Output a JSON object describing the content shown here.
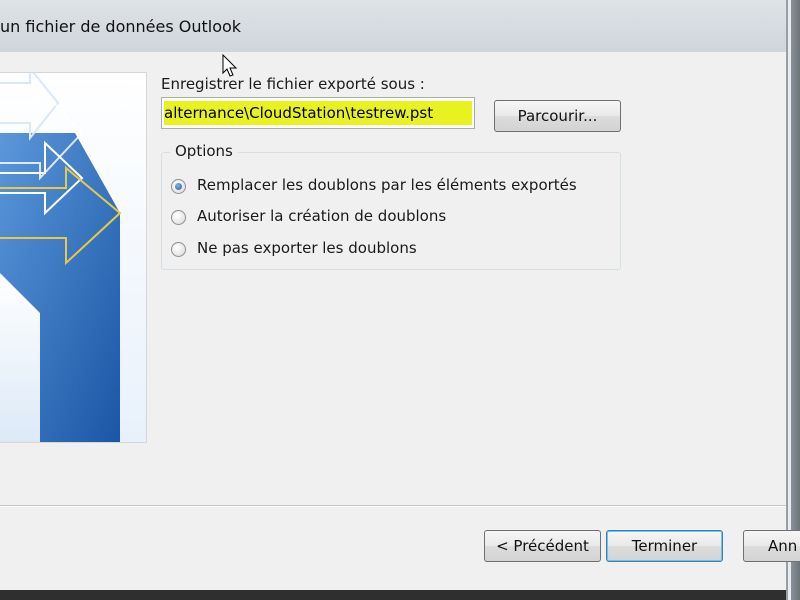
{
  "window": {
    "title": "un fichier de données Outlook"
  },
  "form": {
    "save_as_label": "Enregistrer le fichier exporté sous :",
    "path_value": "alternance\\CloudStation\\testrew.pst",
    "browse_label": "Parcourir..."
  },
  "options": {
    "legend": "Options",
    "items": [
      {
        "label": "Remplacer les doublons par les éléments exportés",
        "selected": true
      },
      {
        "label": "Autoriser la création de doublons",
        "selected": false
      },
      {
        "label": "Ne pas exporter les doublons",
        "selected": false
      }
    ]
  },
  "footer": {
    "back_label": "< Précédent",
    "finish_label": "Terminer",
    "cancel_label": "Ann"
  },
  "colors": {
    "highlight": "#e8f221",
    "banner_blue": "#1f5fb0",
    "arrow_outline": "#e6c94a"
  }
}
